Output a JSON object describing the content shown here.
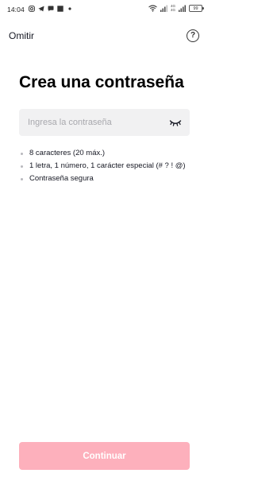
{
  "status_bar": {
    "time": "14:04",
    "left_icons": [
      "instagram-icon",
      "telegram-icon",
      "chat-icon",
      "square-notification-icon",
      "dot-icon"
    ],
    "network_label_top": "4G",
    "network_label_bottom": "4G",
    "battery_level": "99"
  },
  "header": {
    "skip_label": "Omitir",
    "help_symbol": "?"
  },
  "title": "Crea una contraseña",
  "password": {
    "value": "",
    "placeholder": "Ingresa la contraseña",
    "toggle_icon": "eye-closed-icon"
  },
  "requirements": [
    "8 caracteres (20 máx.)",
    "1 letra, 1 número, 1 carácter especial (# ? ! @)",
    "Contraseña segura"
  ],
  "continue_label": "Continuar",
  "colors": {
    "continue_button_disabled": "#fdb0bc",
    "input_background": "#f1f1f2",
    "bullet": "#b8b8bd",
    "text": "#161823"
  }
}
